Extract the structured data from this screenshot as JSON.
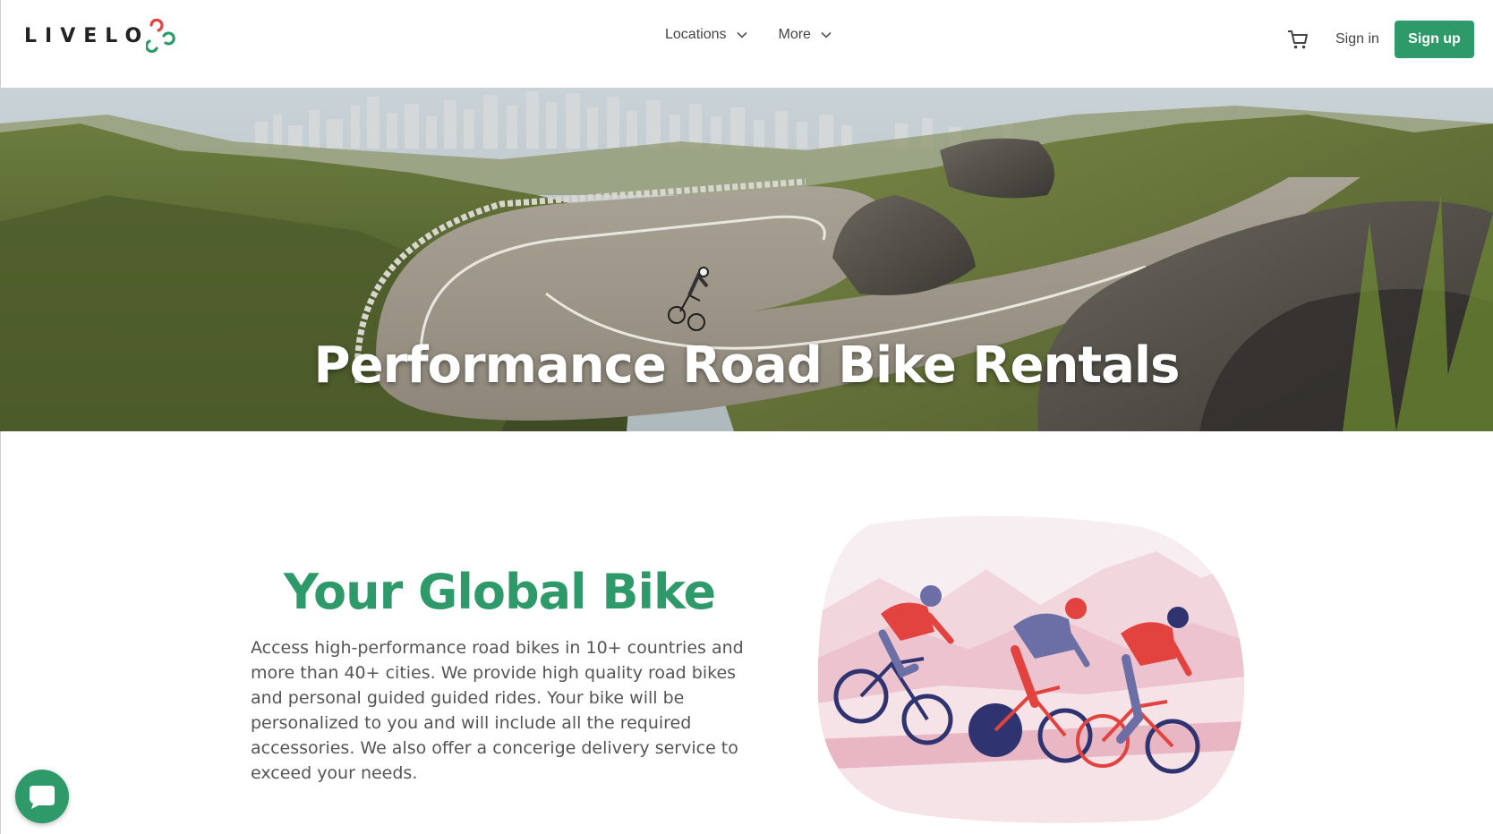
{
  "brand": {
    "name": "LIVELO"
  },
  "nav": {
    "items": [
      {
        "label": "Locations"
      },
      {
        "label": "More"
      }
    ]
  },
  "header": {
    "cart_icon": "cart-icon",
    "signin_label": "Sign in",
    "signup_label": "Sign up"
  },
  "hero": {
    "title": "Performance Road Bike Rentals"
  },
  "intro": {
    "title": "Your Global Bike",
    "body": "Access high-performance road bikes in 10+ countries and more than 40+ cities. We provide high quality road bikes and personal guided guided rides. Your bike will be personalized to you and will include all the required accessories. We also offer a concerige delivery service to exceed your needs."
  },
  "colors": {
    "accent": "#2e9a6a",
    "logo_red": "#e2433f",
    "logo_green": "#2e9a6a"
  },
  "chat": {
    "icon": "chat-bubble-icon"
  }
}
